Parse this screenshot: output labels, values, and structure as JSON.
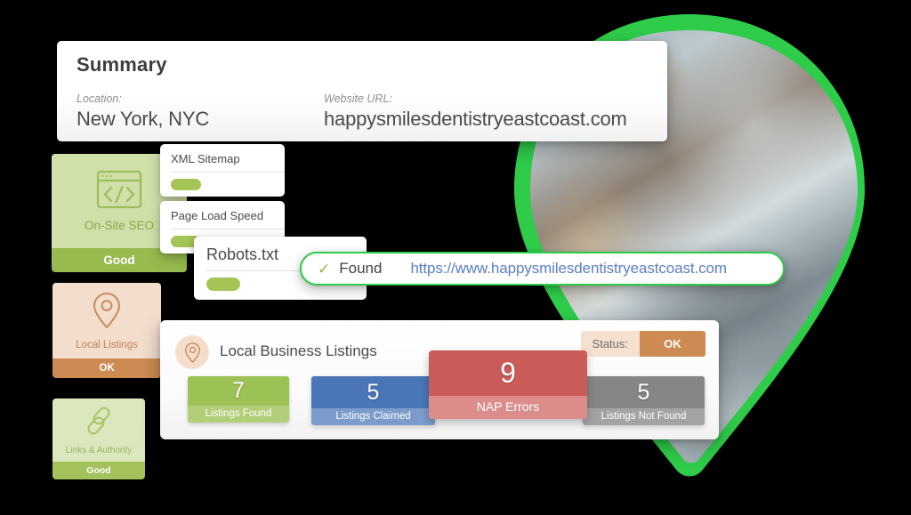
{
  "summary": {
    "title": "Summary",
    "location_label": "Location:",
    "location_value": "New York, NYC",
    "url_label": "Website URL:",
    "url_value": "happysmilesdentistryeastcoast.com"
  },
  "score_cards": [
    {
      "icon": "code-window-icon",
      "label": "On-Site SEO",
      "status": "Good",
      "accent": "#97bb4f"
    },
    {
      "icon": "map-pin-icon",
      "label": "Local Listings",
      "status": "OK",
      "accent": "#cd8a53"
    },
    {
      "icon": "link-chain-icon",
      "label": "Links & Authority",
      "status": "Good",
      "accent": "#a4c25b"
    }
  ],
  "check_cards": [
    {
      "title": "XML Sitemap",
      "toggle": "on"
    },
    {
      "title": "Page Load Speed",
      "toggle": "on"
    },
    {
      "title": "Robots.txt",
      "toggle": "on"
    }
  ],
  "found_pill": {
    "check_glyph": "✓",
    "label": "Found",
    "url": "https://www.happysmilesdentistryeastcoast.com",
    "border_color": "#2ecc4a",
    "url_color": "#5b7fc4"
  },
  "listings": {
    "icon": "map-pin-icon",
    "title": "Local Business Listings",
    "status_label": "Status:",
    "status_value": "OK",
    "stats": [
      {
        "value": "7",
        "caption": "Listings Found",
        "color": "#9cc155"
      },
      {
        "value": "5",
        "caption": "Listings Claimed",
        "color": "#4a76b8"
      },
      {
        "value": "9",
        "caption": "NAP Errors",
        "color": "#cb5b58"
      },
      {
        "value": "5",
        "caption": "Listings Not Found",
        "color": "#868686"
      }
    ]
  },
  "map_pin": {
    "icon": "location-pin-graphic",
    "border_color": "#2fcc4a",
    "photo": "aerial-city-photo"
  }
}
